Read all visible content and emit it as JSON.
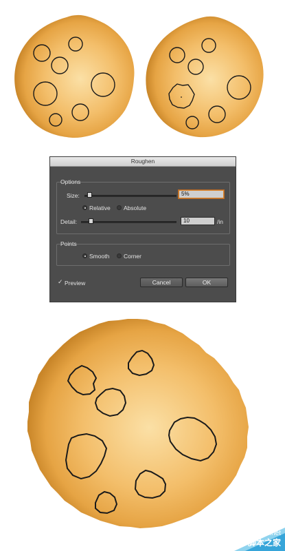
{
  "dialog": {
    "title": "Roughen",
    "options_label": "Options",
    "size_label": "Size:",
    "size_value": "5%",
    "size_level_percent": 5,
    "relative_label": "Relative",
    "absolute_label": "Absolute",
    "relative_selected": true,
    "detail_label": "Detail:",
    "detail_value": "10",
    "detail_unit": "/in",
    "detail_level_fraction": 0.1,
    "points_label": "Points",
    "smooth_label": "Smooth",
    "corner_label": "Corner",
    "smooth_selected": true,
    "preview_label": "Preview",
    "preview_checked": true,
    "cancel_label": "Cancel",
    "ok_label": "OK"
  },
  "watermark": {
    "line1": "jb51.net",
    "line2": "脚本之家"
  },
  "colors": {
    "cookie_center": "#fbe0a6",
    "cookie_mid": "#f3be6a",
    "cookie_edge": "#c98629",
    "dialog_bg": "#4c4c4c",
    "accent": "#d9852c"
  }
}
